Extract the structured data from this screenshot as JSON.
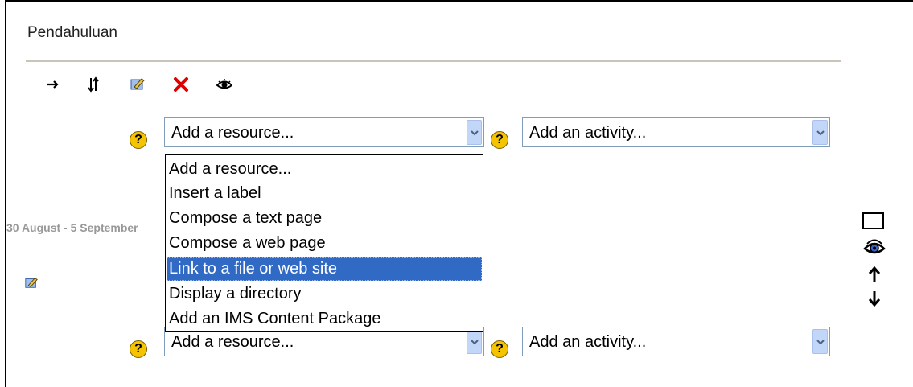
{
  "section": {
    "title": "Pendahuluan"
  },
  "toolbar": {
    "icons": [
      "move-arrow-icon",
      "move-updown-icon",
      "edit-icon",
      "delete-icon",
      "visibility-eye-icon"
    ]
  },
  "row1": {
    "resource_select": {
      "value": "Add a resource..."
    },
    "activity_select": {
      "value": "Add an activity..."
    }
  },
  "row2": {
    "resource_select": {
      "value": "Add a resource..."
    },
    "activity_select": {
      "value": "Add an activity..."
    }
  },
  "dropdown": {
    "options": [
      "Add a resource...",
      "Insert a label",
      "Compose a text page",
      "Compose a web page",
      "Link to a file or web site",
      "Display a directory",
      "Add an IMS Content Package"
    ],
    "selected_index": 4
  },
  "week": {
    "date_label": "30 August - 5 September"
  },
  "help_glyph": "?",
  "colors": {
    "highlight": "#316ac5",
    "help": "#f4c400",
    "rule": "#c9c4b7",
    "date_text": "#999999"
  }
}
